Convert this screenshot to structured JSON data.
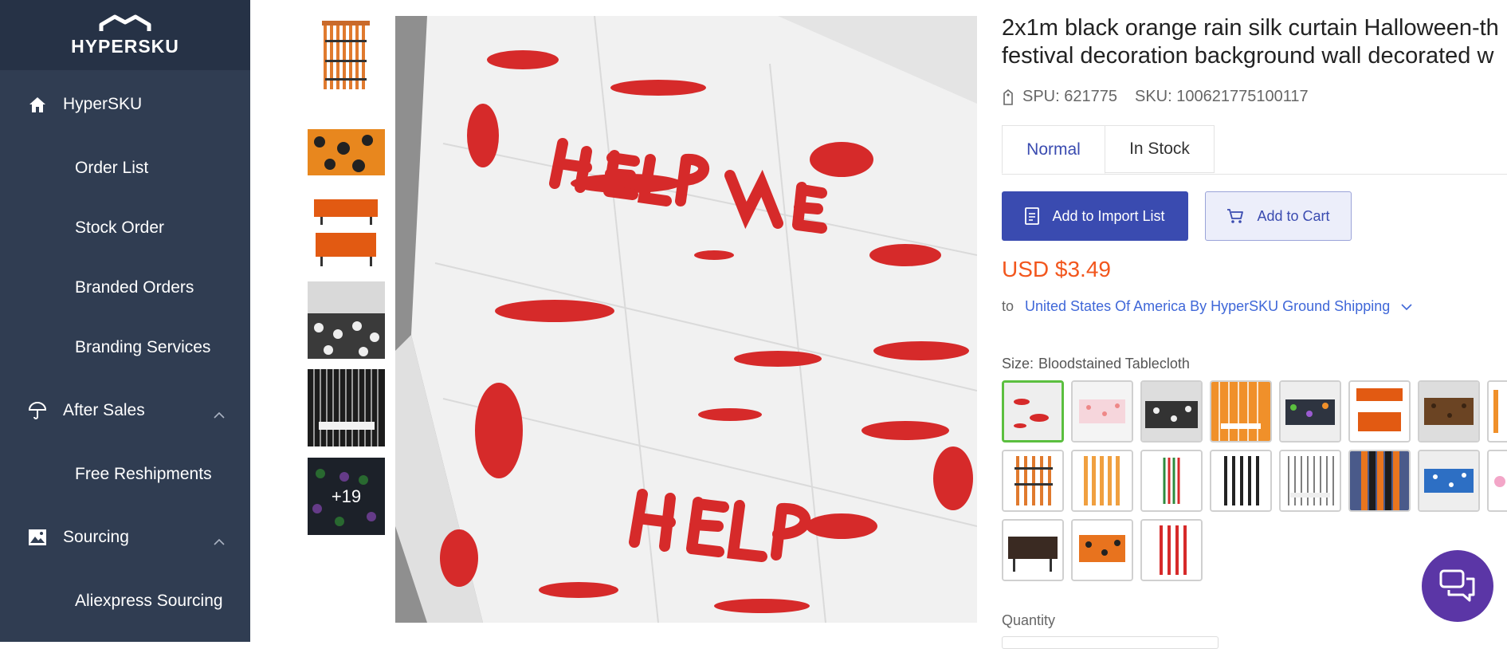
{
  "sidebar": {
    "brand": "HYPERSKU",
    "items": [
      {
        "label": "HyperSKU",
        "icon": "home-icon"
      },
      {
        "label": "Order List"
      },
      {
        "label": "Stock Order"
      },
      {
        "label": "Branded Orders"
      },
      {
        "label": "Branding Services"
      },
      {
        "label": "After Sales",
        "icon": "umbrella-icon"
      },
      {
        "label": "Free Reshipments"
      },
      {
        "label": "Sourcing",
        "icon": "image-icon"
      },
      {
        "label": "Aliexpress Sourcing"
      }
    ]
  },
  "gallery": {
    "more_count": "+19"
  },
  "product": {
    "title_line1": "2x1m black orange rain silk curtain Halloween-th",
    "title_line2": "festival decoration background wall decorated w",
    "spu": "SPU: 621775",
    "sku": "SKU: 100621775100117",
    "tabs": [
      "Normal",
      "In Stock"
    ],
    "add_import_label": "Add to Import List",
    "add_cart_label": "Add to Cart",
    "price": "USD $3.49",
    "ship_to": "to",
    "shipping": "United States Of America By HyperSKU Ground Shipping",
    "size_label": "Size:",
    "size_value": "Bloodstained Tablecloth",
    "quantity_label": "Quantity"
  },
  "colors": {
    "sidebar_bg": "#303d52",
    "accent": "#3a4bb0",
    "price": "#f2561d",
    "link": "#3f67d8",
    "selected_swatch": "#5bbf3f",
    "chat_bg": "#5b36a6"
  }
}
